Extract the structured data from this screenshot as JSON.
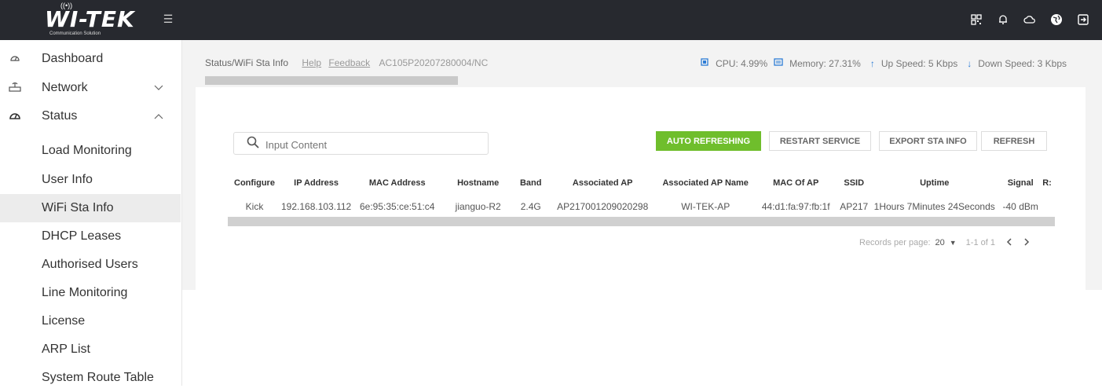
{
  "brand": {
    "name": "WI-TEK",
    "tagline": "Communication Solution"
  },
  "topbar": {
    "icons": [
      "qr-code-icon",
      "bell-icon",
      "cloud-icon",
      "globe-icon",
      "logout-icon"
    ]
  },
  "sidebar": {
    "items": [
      {
        "label": "Dashboard",
        "icon": "dashboard-icon"
      },
      {
        "label": "Network",
        "icon": "router-icon",
        "chevron": "down"
      },
      {
        "label": "Status",
        "icon": "gauge-icon",
        "chevron": "up"
      }
    ],
    "status_children": [
      "Load Monitoring",
      "User Info",
      "WiFi Sta Info",
      "DHCP Leases",
      "Authorised Users",
      "Line Monitoring",
      "License",
      "ARP List",
      "System Route Table"
    ],
    "active": "WiFi Sta Info"
  },
  "breadcrumb": {
    "path": "Status/WiFi Sta Info",
    "help": "Help",
    "feedback": "Feedback",
    "serial": "AC105P20207280004/NC"
  },
  "stats": {
    "cpu": "CPU: 4.99%",
    "memory": "Memory: 27.31%",
    "up": "Up Speed: 5 Kbps",
    "down": "Down Speed: 3 Kbps"
  },
  "search": {
    "placeholder": "Input Content"
  },
  "buttons": {
    "auto": "AUTO REFRESHING",
    "restart": "RESTART SERVICE",
    "export": "EXPORT STA INFO",
    "refresh": "REFRESH"
  },
  "colors": {
    "accent_green": "#6fbe2c",
    "topbar": "#27292f",
    "stat_icon": "#2e7dd6"
  },
  "table": {
    "columns": [
      "Configure",
      "IP Address",
      "MAC Address",
      "Hostname",
      "Band",
      "Associated AP",
      "Associated AP Name",
      "MAC Of AP",
      "SSID",
      "Uptime",
      "Signal",
      "R:"
    ],
    "rows": [
      [
        "Kick",
        "192.168.103.112",
        "6e:95:35:ce:51:c4",
        "jianguo-R2",
        "2.4G",
        "AP217001209020298",
        "WI-TEK-AP",
        "44:d1:fa:97:fb:1f",
        "AP217",
        "1Hours 7Minutes 24Seconds",
        "-40 dBm",
        ""
      ]
    ]
  },
  "pager": {
    "label": "Records per page:",
    "per_page": "20",
    "range": "1-1 of 1"
  }
}
